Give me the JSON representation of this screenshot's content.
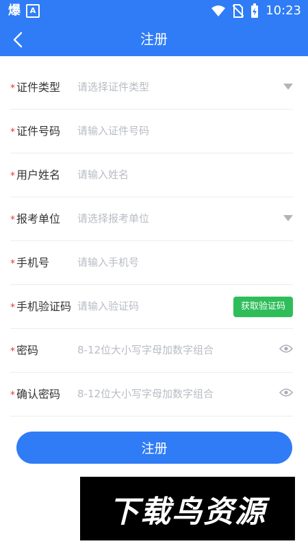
{
  "status_bar": {
    "app_icon": "爆",
    "a_icon": "A",
    "time": "10:23"
  },
  "header": {
    "title": "注册"
  },
  "form": {
    "required_mark": "*",
    "fields": [
      {
        "label": "证件类型",
        "placeholder": "请选择证件类型",
        "value": ""
      },
      {
        "label": "证件号码",
        "placeholder": "请输入证件号码",
        "value": ""
      },
      {
        "label": "用户姓名",
        "placeholder": "请输入姓名",
        "value": ""
      },
      {
        "label": "报考单位",
        "placeholder": "请选择报考单位",
        "value": ""
      },
      {
        "label": "手机号",
        "placeholder": "请输入手机号",
        "value": ""
      },
      {
        "label": "手机验证码",
        "placeholder": "请输入验证码",
        "value": ""
      },
      {
        "label": "密码",
        "placeholder": "8-12位大小写字母加数字组合",
        "value": ""
      },
      {
        "label": "确认密码",
        "placeholder": "8-12位大小写字母加数字组合",
        "value": ""
      }
    ],
    "get_code_label": "获取验证码",
    "submit_label": "注册"
  },
  "watermark": {
    "text": "下载鸟资源"
  },
  "colors": {
    "primary": "#2f7cf6",
    "success": "#2fbd5a",
    "required": "#e53935"
  }
}
